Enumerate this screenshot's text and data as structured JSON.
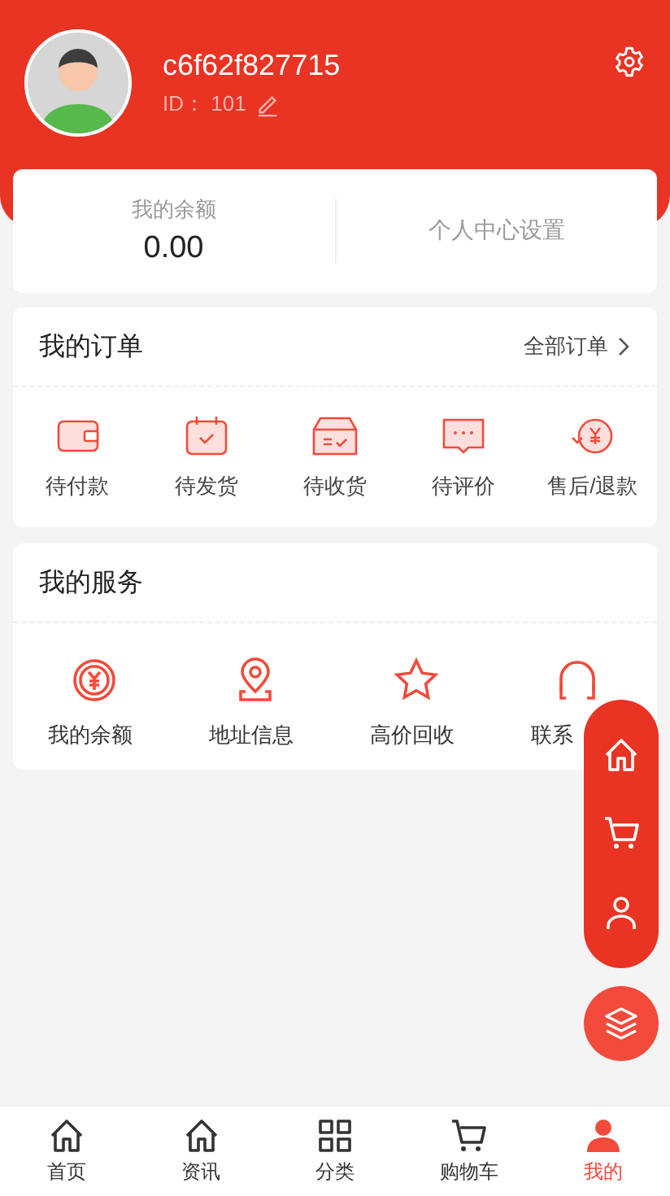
{
  "profile": {
    "username": "c6f62f827715",
    "id_label": "ID：",
    "id_value": "101"
  },
  "summary": {
    "balance_label": "我的余额",
    "balance_value": "0.00",
    "settings_link": "个人中心设置"
  },
  "orders": {
    "title": "我的订单",
    "all_link": "全部订单",
    "items": [
      {
        "kind": "wallet",
        "label": "待付款"
      },
      {
        "kind": "calendar",
        "label": "待发货"
      },
      {
        "kind": "box",
        "label": "待收货"
      },
      {
        "kind": "chat",
        "label": "待评价"
      },
      {
        "kind": "refund",
        "label": "售后/退款"
      }
    ]
  },
  "services": {
    "title": "我的服务",
    "items": [
      {
        "kind": "coin",
        "label": "我的余额"
      },
      {
        "kind": "pin",
        "label": "地址信息"
      },
      {
        "kind": "star",
        "label": "高价回收"
      },
      {
        "kind": "headset",
        "label": "联系"
      }
    ]
  },
  "floating_menu": [
    {
      "kind": "home"
    },
    {
      "kind": "cart"
    },
    {
      "kind": "user"
    }
  ],
  "bottom_nav": [
    {
      "kind": "home",
      "label": "首页",
      "selected": false
    },
    {
      "kind": "home",
      "label": "资讯",
      "selected": false
    },
    {
      "kind": "grid",
      "label": "分类",
      "selected": false
    },
    {
      "kind": "cart",
      "label": "购物车",
      "selected": false
    },
    {
      "kind": "user",
      "label": "我的",
      "selected": true
    }
  ]
}
